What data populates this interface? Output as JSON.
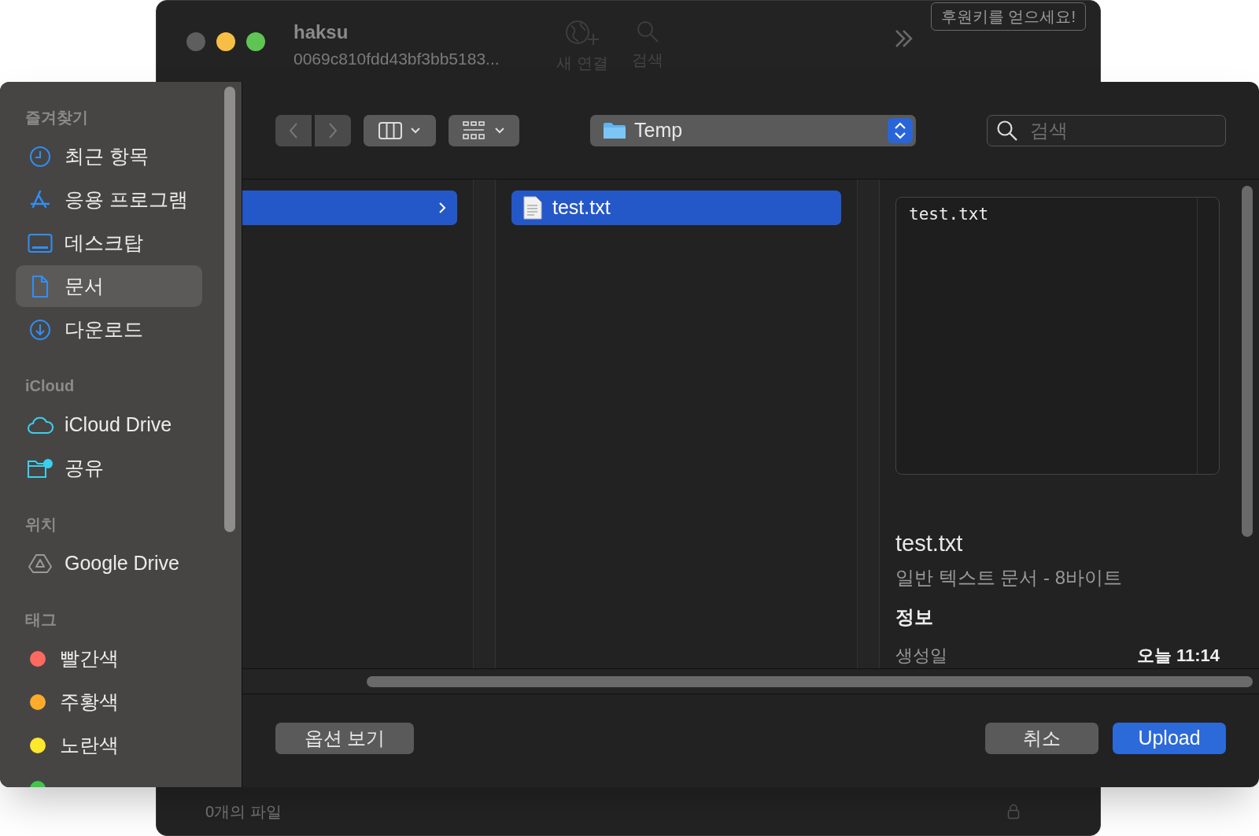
{
  "back_window": {
    "title": "haksu",
    "subtitle": "0069c810fdd43bf3bb5183...",
    "toolbar": [
      {
        "label": "새 연결",
        "kind": "globe"
      },
      {
        "label": "검색",
        "kind": "search"
      }
    ],
    "badge": "후원키를 얻으세요!",
    "status_bar": "0개의 파일"
  },
  "sidebar": {
    "sections": [
      {
        "title": "즐겨찾기",
        "items": [
          {
            "label": "최근 항목",
            "kind": "clock",
            "selected": false
          },
          {
            "label": "응용 프로그램",
            "kind": "apps",
            "selected": false
          },
          {
            "label": "데스크탑",
            "kind": "desktop",
            "selected": false
          },
          {
            "label": "문서",
            "kind": "doc",
            "selected": true
          },
          {
            "label": "다운로드",
            "kind": "download",
            "selected": false
          }
        ]
      },
      {
        "title": "iCloud",
        "items": [
          {
            "label": "iCloud Drive",
            "kind": "cloud",
            "selected": false
          },
          {
            "label": "공유",
            "kind": "shared",
            "selected": false
          }
        ]
      },
      {
        "title": "위치",
        "items": [
          {
            "label": "Google Drive",
            "kind": "drive",
            "selected": false
          }
        ]
      },
      {
        "title": "태그",
        "items": [
          {
            "label": "빨간색",
            "kind": "tag",
            "color": "#fe6a5f",
            "selected": false
          },
          {
            "label": "주황색",
            "kind": "tag",
            "color": "#fdab2a",
            "selected": false
          },
          {
            "label": "노란색",
            "kind": "tag",
            "color": "#fde82b",
            "selected": false
          },
          {
            "kind": "tag",
            "color": "#3ec74b",
            "selected": false
          }
        ]
      }
    ]
  },
  "toolbar": {
    "location": "Temp",
    "search": {
      "placeholder": "검색"
    }
  },
  "columns": [
    {
      "items": [
        {
          "selected": true
        }
      ]
    },
    {
      "items": [
        {
          "label": "test.txt",
          "selected": true
        }
      ]
    }
  ],
  "preview": {
    "content": "test.txt",
    "name": "test.txt",
    "description": "일반 텍스트 문서 - 8바이트",
    "info_title": "정보",
    "info": [
      {
        "label": "생성일",
        "value": "오늘 11:14"
      }
    ]
  },
  "buttons": {
    "options": "옵션 보기",
    "cancel": "취소",
    "confirm": "Upload"
  }
}
